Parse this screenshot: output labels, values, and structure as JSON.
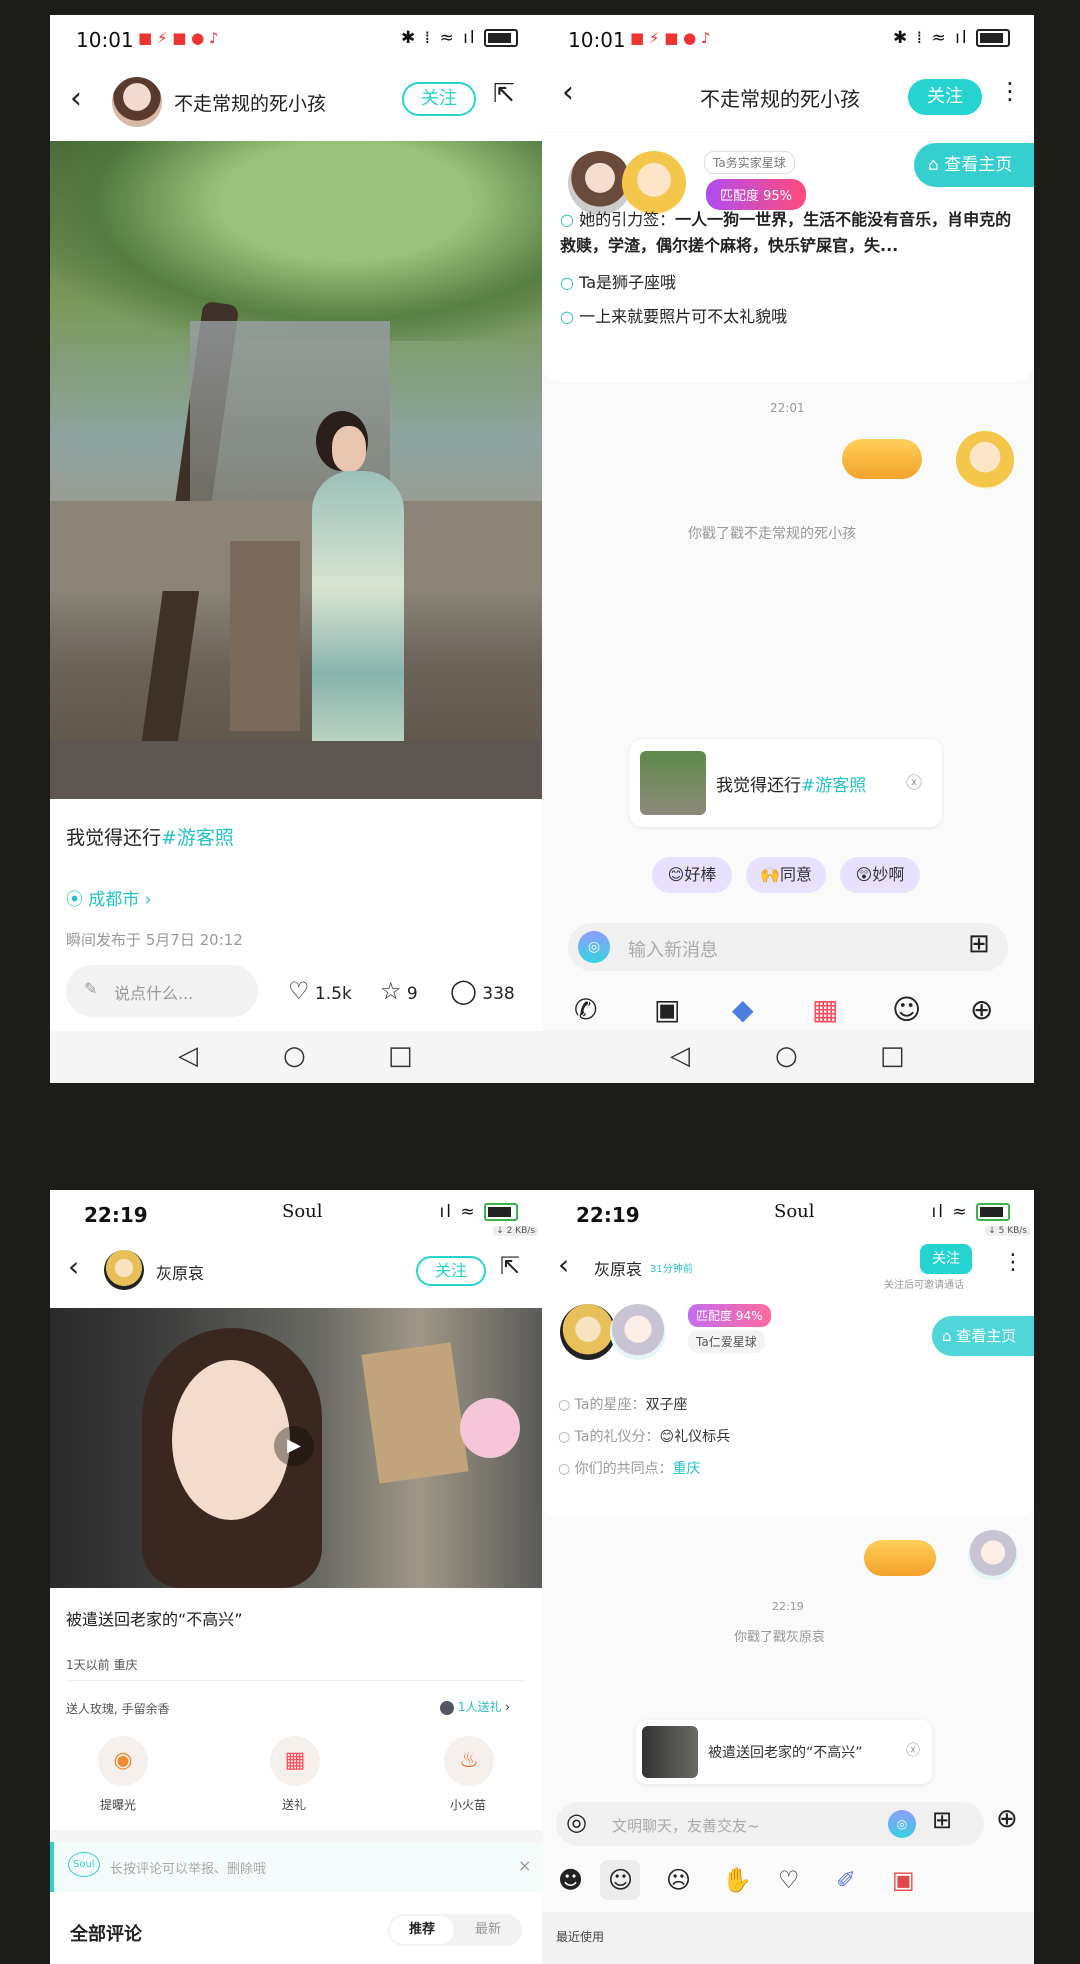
{
  "p1": {
    "status_time": "10:01",
    "username": "不走常规的死小孩",
    "follow_label": "关注",
    "caption_text": "我觉得还行",
    "caption_tag": "#游客照",
    "location": "成都市",
    "publish_time": "瞬间发布于 5月7日 20:12",
    "comment_placeholder": "说点什么...",
    "likes": "1.5k",
    "stars": "9",
    "comments": "338"
  },
  "p2": {
    "status_time": "10:01",
    "title": "不走常规的死小孩",
    "follow_label": "关注",
    "planet_tag": "Ta务实家星球",
    "match_label": "匹配度 95%",
    "view_home": "查看主页",
    "gravity_label": "她的引力签：",
    "gravity_text": "一人一狗一世界，生活不能没有音乐，肖申克的救赎，学渣，偶尔搓个麻将，快乐铲屎官，失...",
    "zodiac": "Ta是狮子座哦",
    "tip": "一上来就要照片可不太礼貌哦",
    "chat_time": "22:01",
    "poke_text": "你戳了戳不走常规的死小孩",
    "quote_text": "我觉得还行",
    "quote_tag": "#游客照",
    "react_1": "好棒",
    "react_2": "同意",
    "react_3": "妙啊",
    "input_placeholder": "输入新消息"
  },
  "p3": {
    "status_time": "22:19",
    "carrier": "Soul",
    "speed": "↓ 2 KB/s",
    "username": "灰原哀",
    "follow_label": "关注",
    "caption": "被遣送回老家的“不高兴”",
    "meta": "1天以前 重庆",
    "gift_hint": "送人玫瑰, 手留余香",
    "gift_count": "1人送礼",
    "action_1": "提曝光",
    "action_2": "送礼",
    "action_3": "小火苗",
    "report_hint": "长按评论可以举报、删除哦",
    "all_comments": "全部评论",
    "sort_recommend": "推荐",
    "sort_latest": "最新"
  },
  "p4": {
    "status_time": "22:19",
    "carrier": "Soul",
    "speed": "↓ 5 KB/s",
    "title": "灰原哀",
    "online": "31分钟前",
    "follow_label": "关注",
    "follow_hint": "关注后可邀请通话",
    "match_label": "匹配度 94%",
    "planet_tag": "Ta仁爱星球",
    "view_home": "查看主页",
    "zodiac_label": "Ta的星座：",
    "zodiac_value": "双子座",
    "etiquette_label": "Ta的礼仪分：",
    "etiquette_value": "礼仪标兵",
    "common_label": "你们的共同点：",
    "common_value": "重庆",
    "chat_time": "22:19",
    "poke_text": "你戳了戳灰原哀",
    "quote_text": "被遣送回老家的“不高兴”",
    "input_placeholder": "文明聊天，友善交友~",
    "recent_used": "最近使用"
  },
  "colors": {
    "accent": "#25d4d0",
    "match_gradient": "#b14cf0",
    "background": "#1c1c19"
  }
}
